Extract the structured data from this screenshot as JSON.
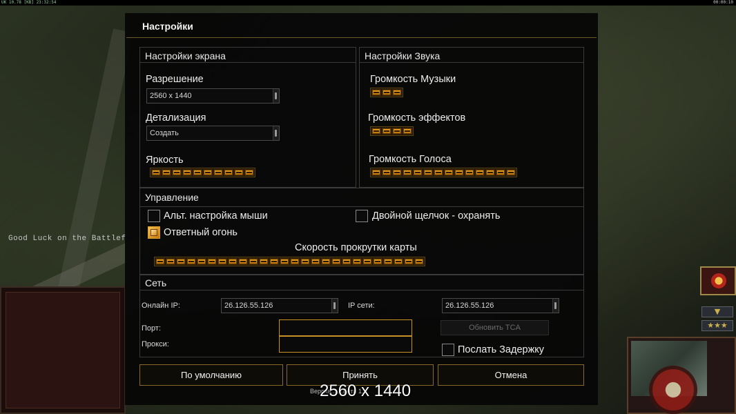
{
  "top_bar": {
    "left_text": "UK 10.78 [KB] 23:32:54",
    "right_text": "00:00:10"
  },
  "background": {
    "ticker_text": "Good Luck on the Battlef"
  },
  "dialog": {
    "title": "Настройки",
    "display": {
      "header": "Настройки экрана",
      "resolution_label": "Разрешение",
      "resolution_value": "2560 x 1440",
      "detail_label": "Детализация",
      "detail_value": "Создать",
      "brightness_label": "Яркость",
      "brightness_segments": 10
    },
    "sound": {
      "header": "Настройки Звука",
      "music_label": "Громкость Музыки",
      "music_segments": 3,
      "effects_label": "Громкость эффектов",
      "effects_segments": 4,
      "voice_label": "Громкость Голоса",
      "voice_segments": 14
    },
    "controls": {
      "header": "Управление",
      "alt_mouse_label": "Альт. настройка мыши",
      "alt_mouse_checked": false,
      "double_click_label": "Двойной щелчок - охранять",
      "double_click_checked": false,
      "return_fire_label": "Ответный огонь",
      "return_fire_checked": true,
      "scroll_speed_label": "Скорость прокрутки карты",
      "scroll_speed_segments": 26
    },
    "network": {
      "header": "Сеть",
      "online_ip_label": "Онлайн IP:",
      "online_ip_value": "26.126.55.126",
      "net_ip_label": "IP сети:",
      "net_ip_value": "26.126.55.126",
      "port_label": "Порт:",
      "port_value": "",
      "proxy_label": "Прокси:",
      "proxy_value": "",
      "update_button": "Обновить TCA",
      "send_delay_label": "Послать Задержку",
      "send_delay_checked": false
    },
    "buttons": {
      "default": "По умолчанию",
      "accept": "Принять",
      "cancel": "Отмена"
    },
    "version_text": "Версия...             ...Бета 1..."
  },
  "overlay_resolution": "2560 x 1440",
  "hud": {
    "chevron": "▼",
    "stars": "★★★"
  }
}
